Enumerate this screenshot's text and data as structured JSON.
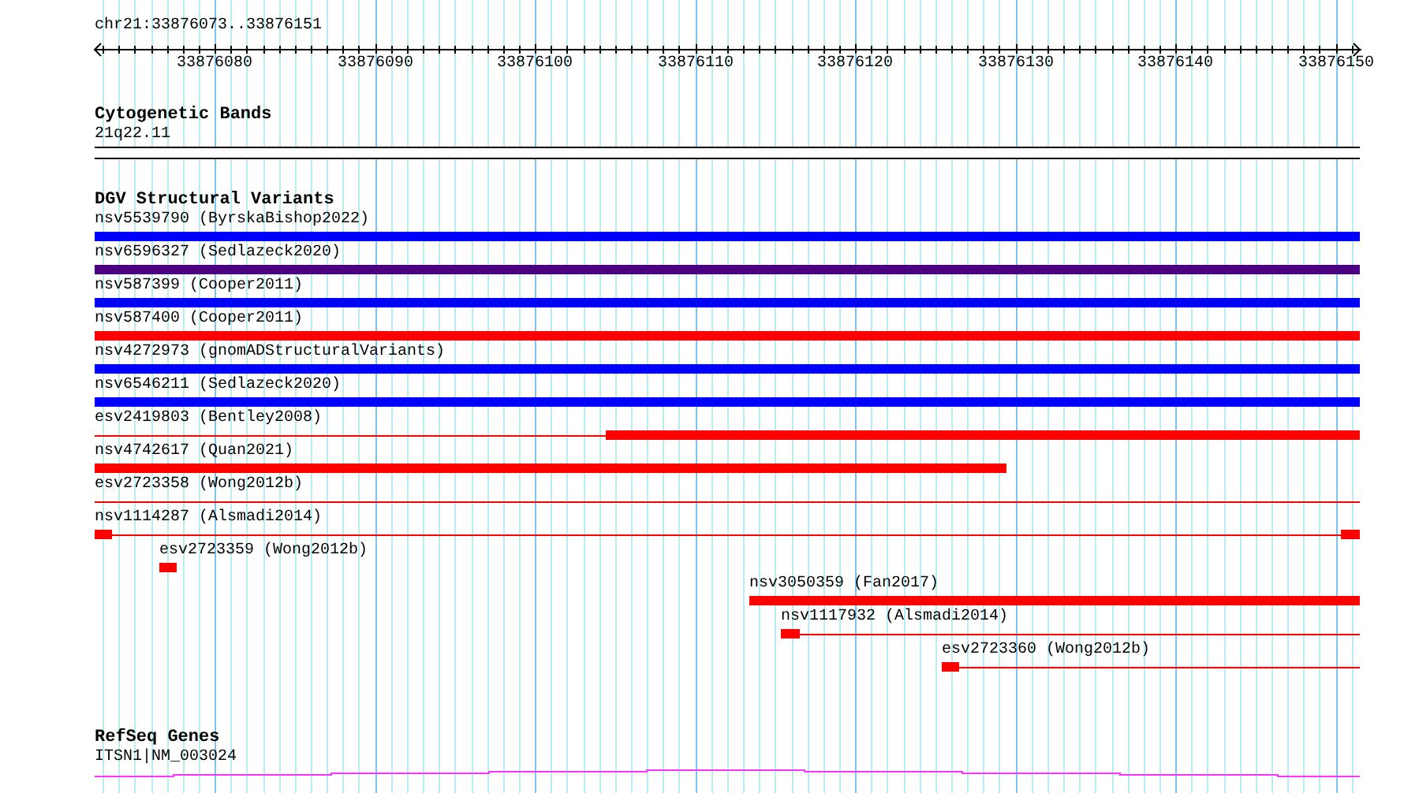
{
  "ruler": {
    "position": "chr21:33876073..33876151",
    "tick_labels": [
      "33876080",
      "33876090",
      "33876100",
      "33876110",
      "33876120",
      "33876130",
      "33876140",
      "33876150"
    ]
  },
  "cytogenetic_bands": {
    "title": "Cytogenetic Bands",
    "band_label": "21q22.11"
  },
  "dgv_structural_variants": {
    "title": "DGV Structural Variants",
    "variants": [
      {
        "label": "nsv5539790 (ByrskaBishop2022)",
        "color": "#0000ff",
        "kind": "solid"
      },
      {
        "label": "nsv6596327 (Sedlazeck2020)",
        "color": "#4b0082",
        "kind": "solid"
      },
      {
        "label": "nsv587399 (Cooper2011)",
        "color": "#0000ff",
        "kind": "solid"
      },
      {
        "label": "nsv587400 (Cooper2011)",
        "color": "#ff0000",
        "kind": "solid"
      },
      {
        "label": "nsv4272973 (gnomADStructuralVariants)",
        "color": "#0000ff",
        "kind": "solid"
      },
      {
        "label": "nsv6546211 (Sedlazeck2020)",
        "color": "#0000ff",
        "kind": "solid"
      },
      {
        "label": "esv2419803 (Bentley2008)",
        "color": "#ff0000",
        "kind": "gapped"
      },
      {
        "label": "nsv4742617 (Quan2021)",
        "color": "#ff0000",
        "kind": "solid"
      },
      {
        "label": "esv2723358 (Wong2012b)",
        "color": "#ff0000",
        "kind": "gapped"
      },
      {
        "label": "nsv1114287 (Alsmadi2014)",
        "color": "#ff0000",
        "kind": "gapped"
      },
      {
        "label": "esv2723359 (Wong2012b)",
        "color": "#ff0000",
        "kind": "solid"
      },
      {
        "label": "nsv3050359 (Fan2017)",
        "color": "#ff0000",
        "kind": "solid"
      },
      {
        "label": "nsv1117932 (Alsmadi2014)",
        "color": "#ff0000",
        "kind": "gapped"
      },
      {
        "label": "esv2723360 (Wong2012b)",
        "color": "#ff0000",
        "kind": "gapped"
      }
    ]
  },
  "refseq_genes": {
    "title": "RefSeq Genes",
    "genes": [
      {
        "label": "ITSN1|NM_003024"
      }
    ]
  }
}
